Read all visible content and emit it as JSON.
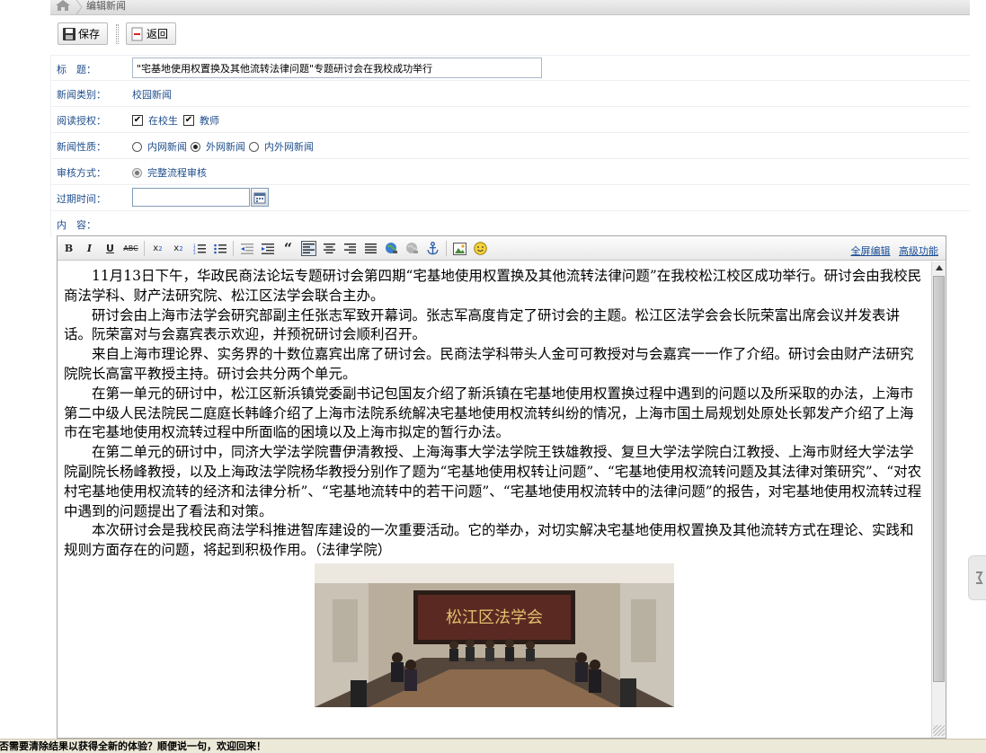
{
  "breadcrumb": {
    "current": "编辑新闻"
  },
  "toolbar": {
    "save_label": "保存",
    "back_label": "返回"
  },
  "form": {
    "title_label": "标　题：",
    "title_value": "\"宅基地使用权置换及其他流转法律问题\"专题研讨会在我校成功举行",
    "category_label": "新闻类别：",
    "category_value": "校园新闻",
    "read_label": "阅读授权：",
    "read_options": [
      "在校生",
      "教师"
    ],
    "nature_label": "新闻性质：",
    "nature_options": [
      "内网新闻",
      "外网新闻",
      "内外网新闻"
    ],
    "nature_selected": "外网新闻",
    "review_label": "审核方式：",
    "review_value": "完整流程审核",
    "expire_label": "过期时间：",
    "expire_value": "",
    "content_label": "内　容："
  },
  "editor": {
    "link_fullscreen": "全屏编辑",
    "link_advanced": "高级功能",
    "paragraphs": [
      "　　11月13日下午，华政民商法论坛专题研讨会第四期“宅基地使用权置换及其他流转法律问题”在我校松江校区成功举行。研讨会由我校民商法学科、财产法研究院、松江区法学会联合主办。",
      "　　研讨会由上海市法学会研究部副主任张志军致开幕词。张志军高度肯定了研讨会的主题。松江区法学会会长阮荣富出席会议并发表讲话。阮荣富对与会嘉宾表示欢迎，并预祝研讨会顺利召开。",
      "　　来自上海市理论界、实务界的十数位嘉宾出席了研讨会。民商法学科带头人金可可教授对与会嘉宾一一作了介绍。研讨会由财产法研究院院长高富平教授主持。研讨会共分两个单元。",
      "　　在第一单元的研讨中，松江区新浜镇党委副书记包国友介绍了新浜镇在宅基地使用权置换过程中遇到的问题以及所采取的办法，上海市第二中级人民法院民二庭庭长韩峰介绍了上海市法院系统解决宅基地使用权流转纠纷的情况，上海市国土局规划处原处长郭发产介绍了上海市在宅基地使用权流转过程中所面临的困境以及上海市拟定的暂行办法。",
      "　　在第二单元的研讨中，同济大学法学院曹伊清教授、上海海事大学法学院王铁雄教授、复旦大学法学院白江教授、上海市财经大学法学院副院长杨峰教授，以及上海政法学院杨华教授分别作了题为“宅基地使用权转让问题”、“宅基地使用权流转问题及其法律对策研究”、“对农村宅基地使用权流转的经济和法律分析”、“宅基地流转中的若干问题”、“宅基地使用权流转中的法律问题”的报告，对宅基地使用权流转过程中遇到的问题提出了看法和对策。",
      "　　本次研讨会是我校民商法学科推进智库建设的一次重要活动。它的举办，对切实解决宅基地使用权置换及其他流转方式在理论、实践和规则方面存在的问题，将起到积极作用。（法律学院）"
    ],
    "photo_banner_text": "松江区法学会"
  },
  "statusbar": {
    "text": "是否需要清除结果以获得全新的体验？顺便说一句，欢迎回来！"
  },
  "colors": {
    "label": "#1f4e8c",
    "link": "#1a4f99"
  }
}
